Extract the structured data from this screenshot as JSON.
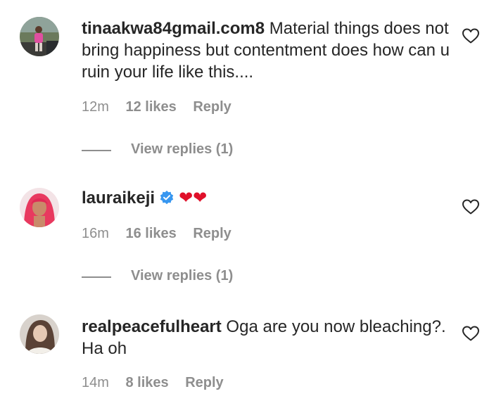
{
  "comments": [
    {
      "username": "tinaakwa84gmail.com8",
      "text": " Material things does not bring happiness but contentment does how can u ruin your life like this....",
      "time": "12m",
      "likes": "12 likes",
      "reply": "Reply",
      "view_replies": "View replies (1)",
      "verified": false
    },
    {
      "username": "lauraikeji",
      "text": "❤❤",
      "time": "16m",
      "likes": "16 likes",
      "reply": "Reply",
      "view_replies": "View replies (1)",
      "verified": true
    },
    {
      "username": "realpeacefulheart",
      "text": " Oga are you now bleaching?. Ha oh",
      "time": "14m",
      "likes": "8 likes",
      "reply": "Reply",
      "verified": false
    }
  ],
  "colors": {
    "text": "#262626",
    "muted": "#8e8e8e",
    "verified_blue": "#3897f0",
    "heart_emoji": "#e0102a"
  },
  "icons": {
    "like": "heart-outline-icon",
    "verified": "verified-badge-icon"
  }
}
